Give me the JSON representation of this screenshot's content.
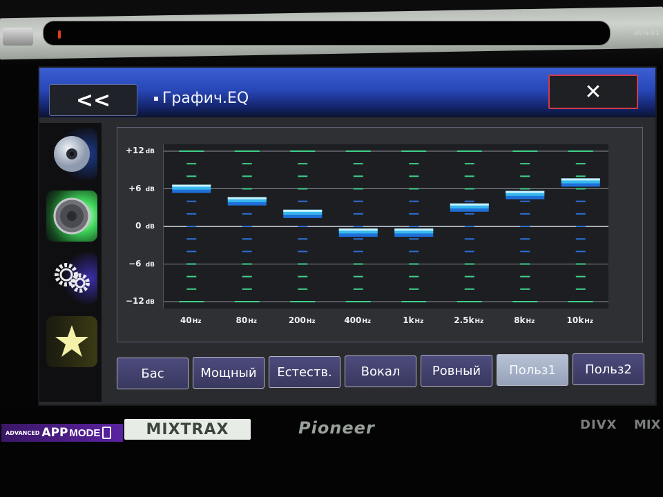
{
  "device": {
    "model_label": "AVH-X1",
    "brand": "Pioneer",
    "badges": {
      "advanced": "ADVANCED",
      "app": "APP",
      "mode": "MODE",
      "mixtrax": "MIXTRAX",
      "divx": "DIVX",
      "mix_partial": "MIX"
    }
  },
  "header": {
    "back_label": "<<",
    "title": "Графич.EQ",
    "close_label": "✕"
  },
  "sidebar": {
    "items": [
      {
        "name": "disc-source",
        "icon": "disc-icon"
      },
      {
        "name": "audio",
        "icon": "speaker-icon",
        "active": true
      },
      {
        "name": "settings",
        "icon": "gears-icon"
      },
      {
        "name": "favorites",
        "icon": "star-icon"
      }
    ]
  },
  "chart_data": {
    "type": "bar",
    "title": "Графич.EQ",
    "categories": [
      "40 Hz",
      "80 Hz",
      "200 Hz",
      "400 Hz",
      "1 kHz",
      "2.5 kHz",
      "8 kHz",
      "10 kHz"
    ],
    "category_labels": [
      {
        "num": "40",
        "unit": "Hz"
      },
      {
        "num": "80",
        "unit": "Hz"
      },
      {
        "num": "200",
        "unit": "Hz"
      },
      {
        "num": "400",
        "unit": "Hz"
      },
      {
        "num": "1k",
        "unit": "Hz"
      },
      {
        "num": "2.5k",
        "unit": "Hz"
      },
      {
        "num": "8k",
        "unit": "Hz"
      },
      {
        "num": "10k",
        "unit": "Hz"
      }
    ],
    "values": [
      6,
      4,
      2,
      -1,
      -1,
      3,
      5,
      7
    ],
    "ylabel": "dB",
    "ylim": [
      -12,
      12
    ],
    "yticks": [
      {
        "value": 12,
        "num": "+12",
        "unit": "dB"
      },
      {
        "value": 6,
        "num": "+6 ",
        "unit": "dB"
      },
      {
        "value": 0,
        "num": "0 ",
        "unit": "dB"
      },
      {
        "value": -6,
        "num": "−6 ",
        "unit": "dB"
      },
      {
        "value": -12,
        "num": "−12",
        "unit": "dB"
      }
    ],
    "minor_step": 2,
    "grid": true,
    "colors": {
      "bar": "#37b7ee",
      "bar_top": "#c8f4ff",
      "tick_pos": "#3fd28a",
      "tick_near": "#2b6fd6",
      "grid": "#8a8f98"
    }
  },
  "presets": {
    "items": [
      {
        "label": "Бас"
      },
      {
        "label": "Мощный"
      },
      {
        "label": "Естеств."
      },
      {
        "label": "Вокал"
      },
      {
        "label": "Ровный"
      },
      {
        "label": "Польз1",
        "active": true
      },
      {
        "label": "Польз2"
      }
    ]
  }
}
